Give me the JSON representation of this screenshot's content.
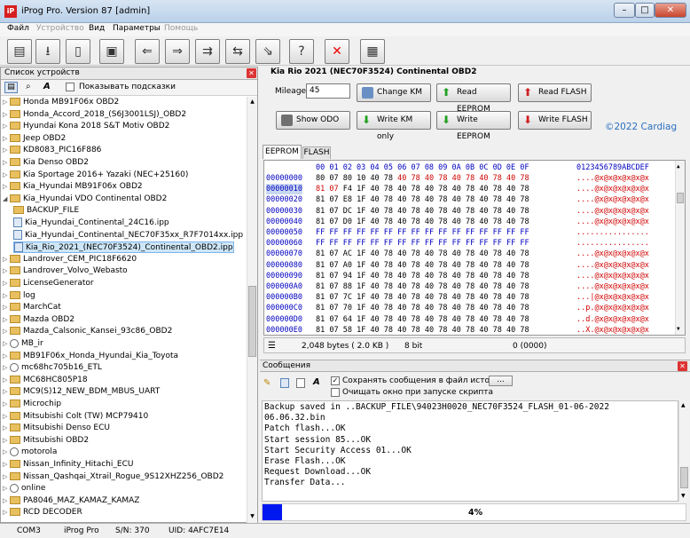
{
  "window": {
    "title": "iProg Pro. Version 87 [admin]",
    "min": "–",
    "max": "□",
    "close": "✕"
  },
  "menu": [
    "Файл",
    "Устройство",
    "Вид",
    "Параметры",
    "Помощь"
  ],
  "device_list": {
    "title": "Список устройств",
    "show_hints": "Показывать подсказки",
    "items": [
      {
        "label": "Honda MB91F06x OBD2",
        "type": "folder",
        "arrow": "▷",
        "level": 0
      },
      {
        "label": "Honda_Accord_2018_(S6J3001LSJ)_OBD2",
        "type": "folder",
        "arrow": "▷",
        "level": 0
      },
      {
        "label": "Hyundai Kona 2018 S&T Motiv OBD2",
        "type": "folder",
        "arrow": "▷",
        "level": 0
      },
      {
        "label": "Jeep OBD2",
        "type": "folder",
        "arrow": "▷",
        "level": 0
      },
      {
        "label": "KD8083_PIC16F886",
        "type": "folder",
        "arrow": "▷",
        "level": 0
      },
      {
        "label": "Kia Denso OBD2",
        "type": "folder",
        "arrow": "▷",
        "level": 0
      },
      {
        "label": "Kia Sportage 2016+ Yazaki (NEC+25160)",
        "type": "folder",
        "arrow": "▷",
        "level": 0
      },
      {
        "label": "Kia_Hyundai MB91F06x OBD2",
        "type": "folder",
        "arrow": "▷",
        "level": 0
      },
      {
        "label": "Kia_Hyundai VDO Continental OBD2",
        "type": "folder",
        "arrow": "◢",
        "level": 0
      },
      {
        "label": "BACKUP_FILE",
        "type": "folder",
        "arrow": "",
        "level": 1
      },
      {
        "label": "Kia_Hyundai_Continental_24C16.ipp",
        "type": "file",
        "arrow": "",
        "level": 1
      },
      {
        "label": "Kia_Hyundai_Continental_NEC70F35xx_R7F7014xx.ipp",
        "type": "file",
        "arrow": "",
        "level": 1
      },
      {
        "label": "Kia_Rio_2021_(NEC70F3524)_Continental_OBD2.ipp",
        "type": "file",
        "arrow": "",
        "level": 1,
        "selected": true
      },
      {
        "label": "Landrover_CEM_PIC18F6620",
        "type": "folder",
        "arrow": "▷",
        "level": 0
      },
      {
        "label": "Landrover_Volvo_Webasto",
        "type": "folder",
        "arrow": "▷",
        "level": 0
      },
      {
        "label": "LicenseGenerator",
        "type": "folder",
        "arrow": "▷",
        "level": 0
      },
      {
        "label": "log",
        "type": "folder",
        "arrow": "▷",
        "level": 0
      },
      {
        "label": "MarchCat",
        "type": "folder",
        "arrow": "▷",
        "level": 0
      },
      {
        "label": "Mazda OBD2",
        "type": "folder",
        "arrow": "▷",
        "level": 0
      },
      {
        "label": "Mazda_Calsonic_Kansei_93c86_OBD2",
        "type": "folder",
        "arrow": "▷",
        "level": 0
      },
      {
        "label": "MB_ir",
        "type": "gear",
        "arrow": "▷",
        "level": 0
      },
      {
        "label": "MB91F06x_Honda_Hyundai_Kia_Toyota",
        "type": "folder",
        "arrow": "▷",
        "level": 0
      },
      {
        "label": "mc68hc705b16_ETL",
        "type": "gear",
        "arrow": "▷",
        "level": 0
      },
      {
        "label": "MC68HC805P18",
        "type": "folder",
        "arrow": "▷",
        "level": 0
      },
      {
        "label": "MC9(S)12_NEW_BDM_MBUS_UART",
        "type": "folder",
        "arrow": "▷",
        "level": 0
      },
      {
        "label": "Microchip",
        "type": "folder",
        "arrow": "▷",
        "level": 0
      },
      {
        "label": "Mitsubishi Colt (TW) MCP79410",
        "type": "folder",
        "arrow": "▷",
        "level": 0
      },
      {
        "label": "Mitsubishi Denso ECU",
        "type": "folder",
        "arrow": "▷",
        "level": 0
      },
      {
        "label": "Mitsubishi OBD2",
        "type": "folder",
        "arrow": "▷",
        "level": 0
      },
      {
        "label": "motorola",
        "type": "gear",
        "arrow": "▷",
        "level": 0
      },
      {
        "label": "Nissan_Infinity_Hitachi_ECU",
        "type": "folder",
        "arrow": "▷",
        "level": 0
      },
      {
        "label": "Nissan_Qashqai_Xtrail_Rogue_9S12XHZ256_OBD2",
        "type": "folder",
        "arrow": "▷",
        "level": 0
      },
      {
        "label": "online",
        "type": "gear",
        "arrow": "▷",
        "level": 0
      },
      {
        "label": "PA8046_MAZ_KAMAZ_KAMAZ",
        "type": "folder",
        "arrow": "▷",
        "level": 0
      },
      {
        "label": "RCD DECODER",
        "type": "folder",
        "arrow": "▷",
        "level": 0
      }
    ]
  },
  "script": {
    "title": "Kia Rio 2021 (NEC70F3524) Continental OBD2",
    "mileage_label": "Mileage:",
    "mileage_value": "45",
    "change_km": "Change KM",
    "read_eeprom": "Read EEPROM",
    "read_flash": "Read FLASH",
    "show_odo": "Show ODO",
    "write_km_only": "Write KM only",
    "write_eeprom": "Write EEPROM",
    "write_flash": "Write FLASH",
    "copyright": "©2022 Cardiag"
  },
  "tabs": [
    "EEPROM",
    "FLASH"
  ],
  "hex": {
    "header_cols": "00 01 02 03 04 05 06 07 08 09 0A 0B 0C 0D 0E 0F",
    "header_ascii": "0123456789ABCDEF",
    "rows": [
      {
        "addr": "00000000",
        "bytes": "80 07 80 10 40 78 40 78 40 78 40 78 40 78 40 78",
        "ascii": "....@x@x@x@x@x@x"
      },
      {
        "addr": "00000010",
        "bytes": "81 07 F4 1F 40 78 40 78 40 78 40 78 40 78 40 78",
        "ascii": "....@x@x@x@x@x@x"
      },
      {
        "addr": "00000020",
        "bytes": "81 07 E8 1F 40 78 40 78 40 78 40 78 40 78 40 78",
        "ascii": "....@x@x@x@x@x@x"
      },
      {
        "addr": "00000030",
        "bytes": "81 07 DC 1F 40 78 40 78 40 78 40 78 40 78 40 78",
        "ascii": "....@x@x@x@x@x@x"
      },
      {
        "addr": "00000040",
        "bytes": "81 07 D0 1F 40 78 40 78 40 78 40 78 40 78 40 78",
        "ascii": "....@x@x@x@x@x@x"
      },
      {
        "addr": "00000050",
        "bytes": "FF FF FF FF FF FF FF FF FF FF FF FF FF FF FF FF",
        "ascii": "................"
      },
      {
        "addr": "00000060",
        "bytes": "FF FF FF FF FF FF FF FF FF FF FF FF FF FF FF FF",
        "ascii": "................"
      },
      {
        "addr": "00000070",
        "bytes": "81 07 AC 1F 40 78 40 78 40 78 40 78 40 78 40 78",
        "ascii": "....@x@x@x@x@x@x"
      },
      {
        "addr": "00000080",
        "bytes": "81 07 A0 1F 40 78 40 78 40 78 40 78 40 78 40 78",
        "ascii": "....@x@x@x@x@x@x"
      },
      {
        "addr": "00000090",
        "bytes": "81 07 94 1F 40 78 40 78 40 78 40 78 40 78 40 78",
        "ascii": "....@x@x@x@x@x@x"
      },
      {
        "addr": "000000A0",
        "bytes": "81 07 88 1F 40 78 40 78 40 78 40 78 40 78 40 78",
        "ascii": "....@x@x@x@x@x@x"
      },
      {
        "addr": "000000B0",
        "bytes": "81 07 7C 1F 40 78 40 78 40 78 40 78 40 78 40 78",
        "ascii": "...|@x@x@x@x@x@x"
      },
      {
        "addr": "000000C0",
        "bytes": "81 07 70 1F 40 78 40 78 40 78 40 78 40 78 40 78",
        "ascii": "..p.@x@x@x@x@x@x"
      },
      {
        "addr": "000000D0",
        "bytes": "81 07 64 1F 40 78 40 78 40 78 40 78 40 78 40 78",
        "ascii": "..d.@x@x@x@x@x@x"
      },
      {
        "addr": "000000E0",
        "bytes": "81 07 58 1F 40 78 40 78 40 78 40 78 40 78 40 78",
        "ascii": "..X.@x@x@x@x@x@x"
      }
    ],
    "size": "2,048 bytes ( 2.0 KB )",
    "bits": "8 bit",
    "pos": "0 (0000)"
  },
  "messages": {
    "title": "Сообщения",
    "save_history": "Сохранять сообщения в файл истории",
    "browse": "...",
    "clear_on_start": "Очищать окно при запуске скрипта",
    "log": [
      "Backup saved in ..BACKUP_FILE\\94023H0020_NEC70F3524_FLASH_01-06-2022",
      "06.06.32.bin",
      "Patch flash...OK",
      "Start session 85...OK",
      "Start Security Access 01...OK",
      "Erase Flash...OK",
      "Request Download...OK",
      "Transfer Data..."
    ],
    "progress_fraction": 0.04,
    "progress_text": "4%"
  },
  "status": {
    "port": "COM3",
    "app": "iProg Pro",
    "sn": "S/N: 370",
    "uid": "UID: 4AFC7E14"
  }
}
